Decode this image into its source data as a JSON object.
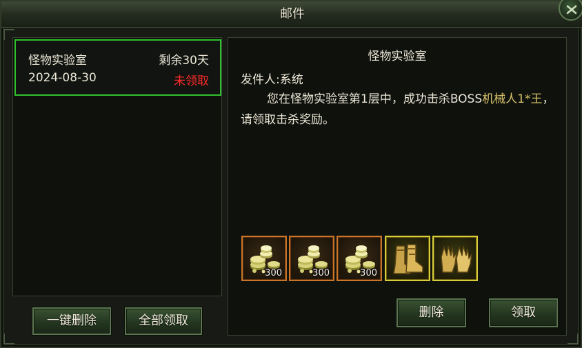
{
  "window": {
    "title": "邮件"
  },
  "mail_list": [
    {
      "title": "怪物实验室",
      "remaining": "剩余30天",
      "date": "2024-08-30",
      "status": "未领取",
      "status_color": "#ff2a2a",
      "selected_border": "#2fc22c"
    }
  ],
  "left_buttons": {
    "delete_all": "一键删除",
    "claim_all": "全部领取"
  },
  "detail": {
    "title": "怪物实验室",
    "sender": "发件人:系统",
    "body_parts": [
      "您在怪物实验室第1层中，成功击杀BOSS",
      "机械人1*王",
      "，请领取击杀奖励。"
    ],
    "highlight_color": "#d8c46a"
  },
  "attachments": [
    {
      "icon": "gold-coins-icon",
      "quantity": "300",
      "rarity": "orange"
    },
    {
      "icon": "gold-coins-icon",
      "quantity": "300",
      "rarity": "orange"
    },
    {
      "icon": "gold-coins-icon",
      "quantity": "300",
      "rarity": "orange"
    },
    {
      "icon": "golden-boots-icon",
      "quantity": "",
      "rarity": "gold"
    },
    {
      "icon": "golden-gloves-icon",
      "quantity": "",
      "rarity": "gold"
    }
  ],
  "right_buttons": {
    "delete": "删除",
    "claim": "领取"
  }
}
